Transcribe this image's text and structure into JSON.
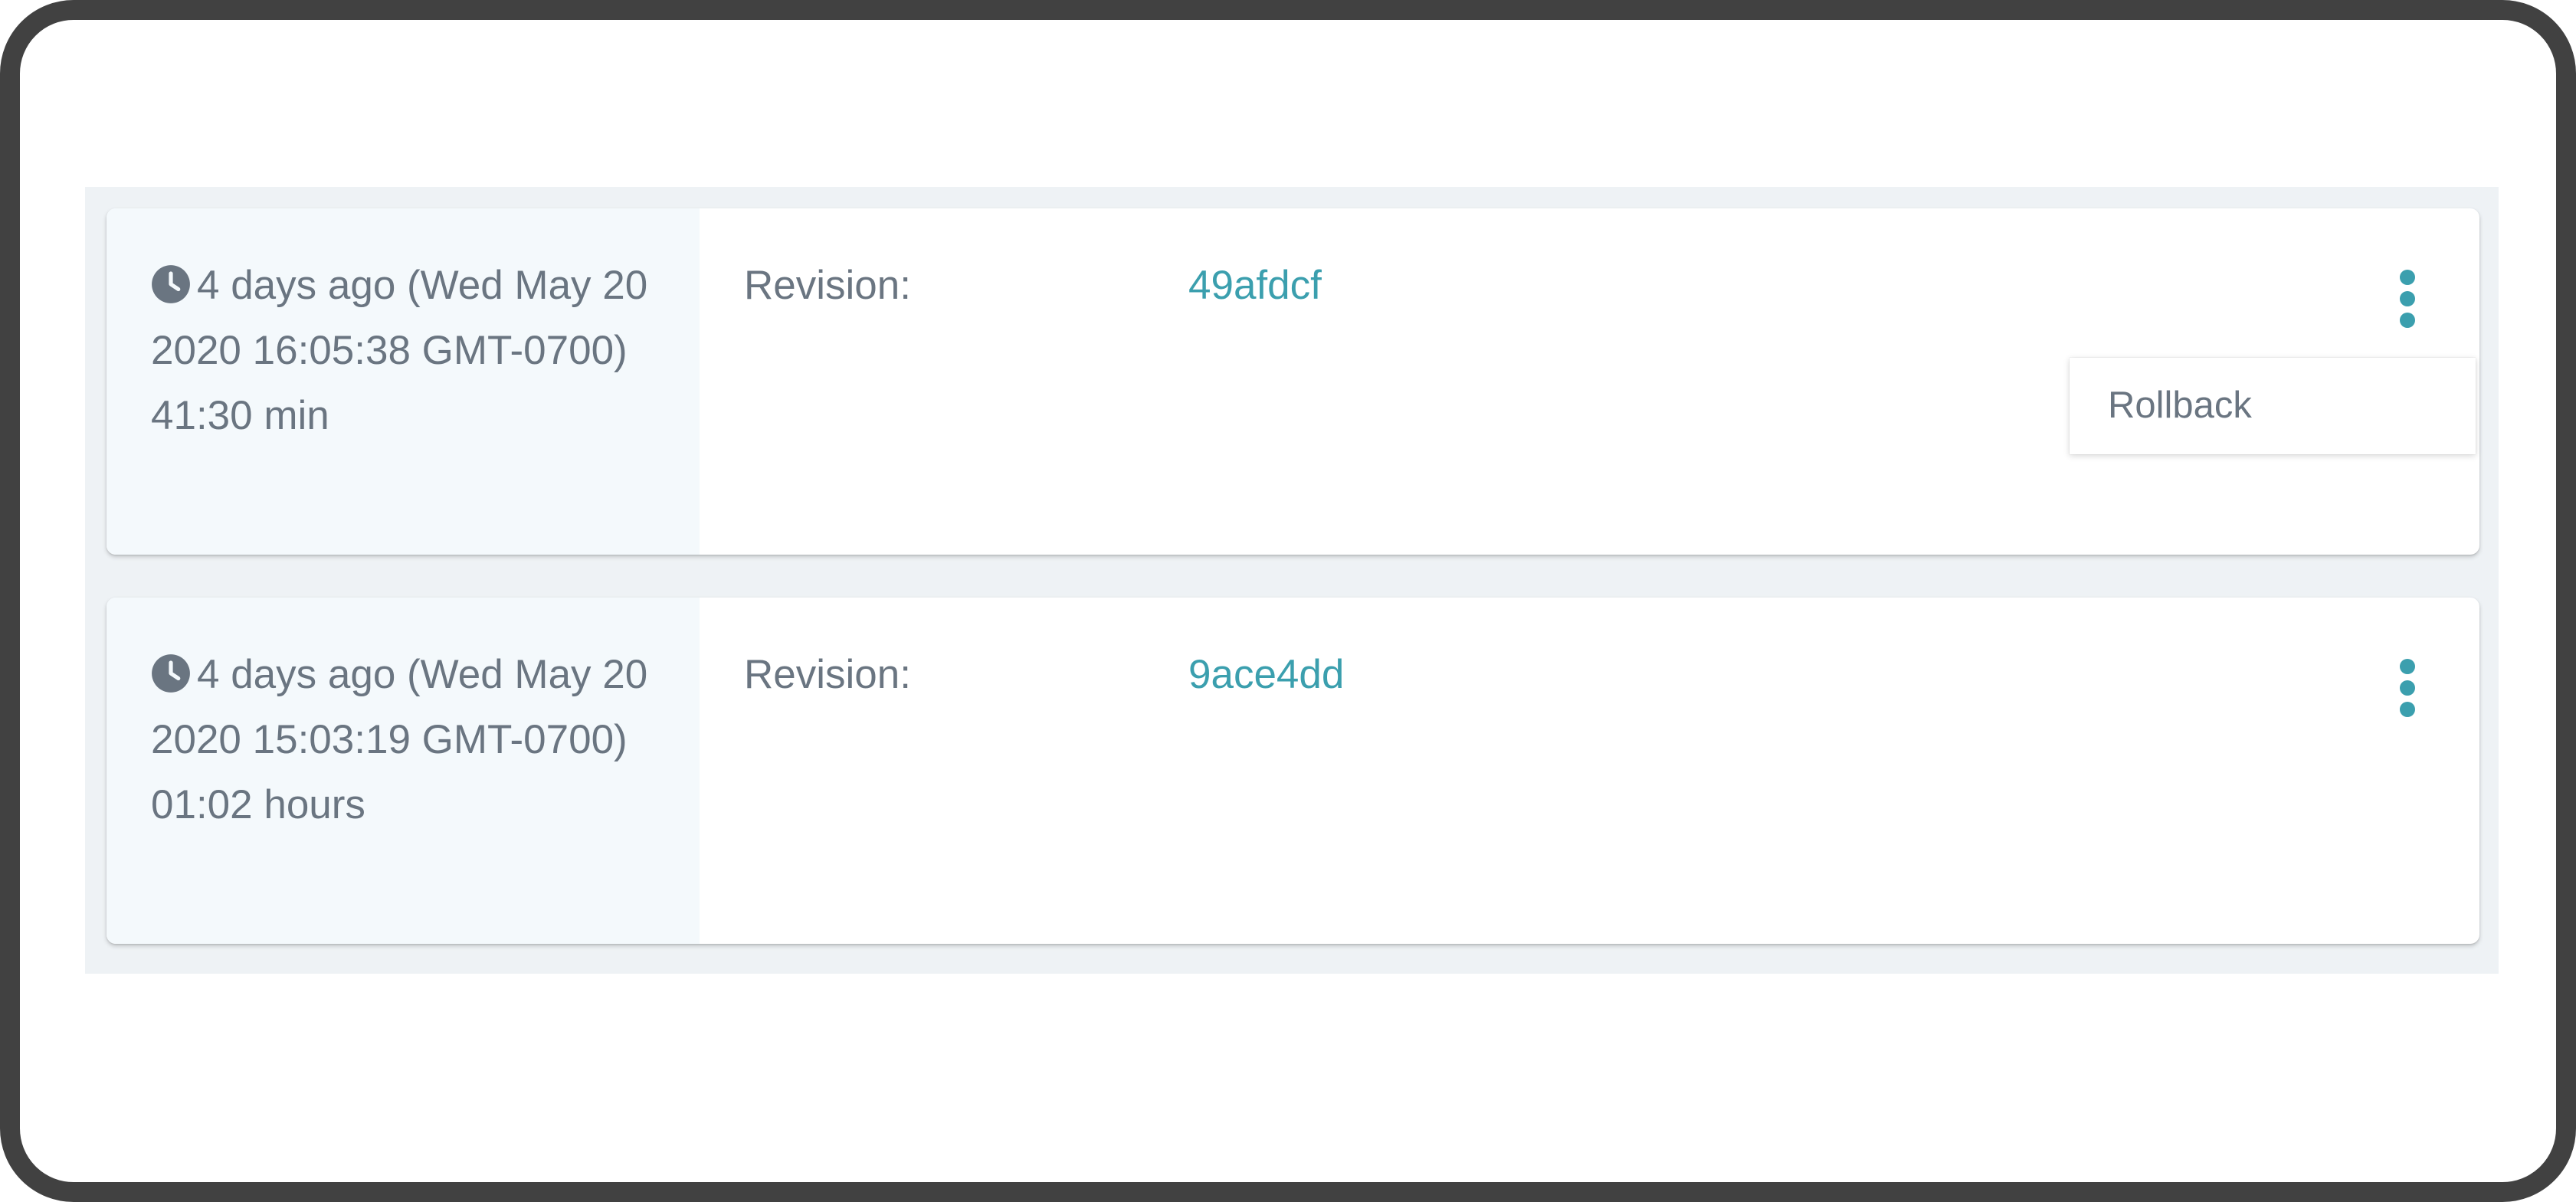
{
  "deployments": [
    {
      "relative_time": "4 days ago (Wed May 20 2020 16:05:38 GMT-0700)",
      "duration": "41:30 min",
      "revision_label": "Revision:",
      "revision_hash": "49afdcf",
      "menu_open": true,
      "menu_items": [
        "Rollback"
      ]
    },
    {
      "relative_time": "4 days ago (Wed May 20 2020 15:03:19 GMT-0700)",
      "duration": "01:02 hours",
      "revision_label": "Revision:",
      "revision_hash": "9ace4dd",
      "menu_open": false
    }
  ],
  "icons": {
    "time": "clock-icon",
    "menu": "more-vertical-icon"
  },
  "colors": {
    "frame": "#414141",
    "panel_background": "#eef2f5",
    "time_column_background": "#f4f9fc",
    "text_muted": "#6a7581",
    "accent": "#3b9fae"
  }
}
